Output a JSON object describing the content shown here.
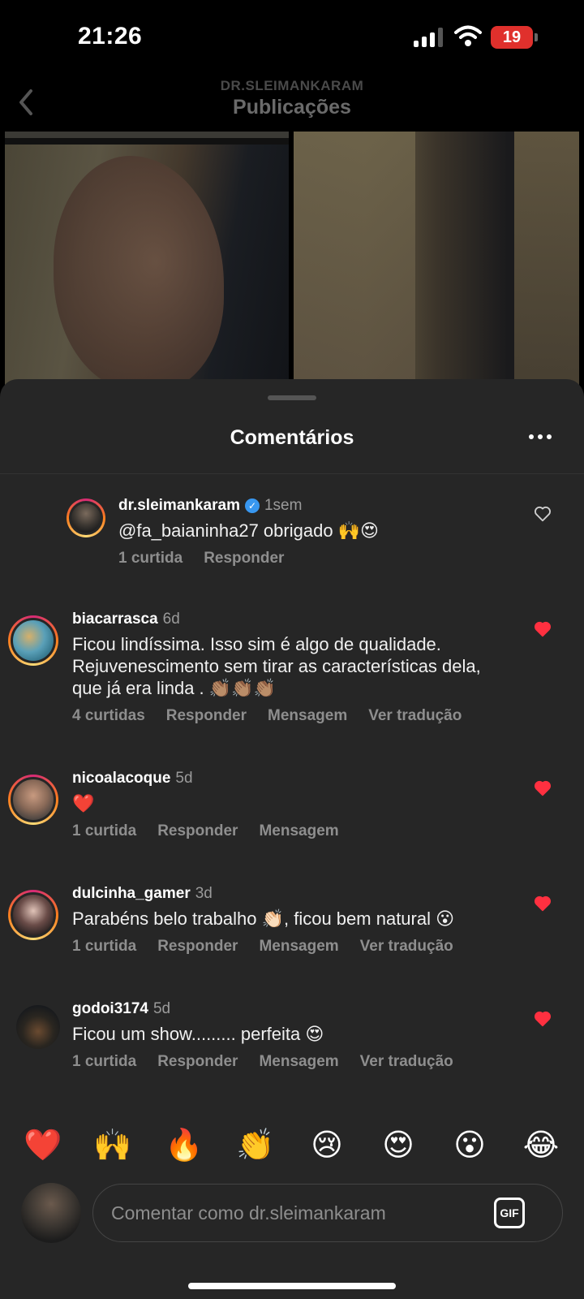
{
  "status_bar": {
    "time": "21:26",
    "battery": "19"
  },
  "header": {
    "subtitle": "DR.SLEIMANKARAM",
    "title": "Publicações"
  },
  "sheet": {
    "title": "Comentários"
  },
  "comments": [
    {
      "username": "dr.sleimankaram",
      "time": "1sem",
      "verified": true,
      "text": "@fa_baianinha27 obrigado 🙌😍",
      "likes": "1 curtida",
      "reply": "Responder",
      "message": "",
      "translate": "",
      "liked": false
    },
    {
      "username": "biacarrasca",
      "time": "6d",
      "text": "Ficou lindíssima. Isso sim é algo de qualidade. Rejuvenescimento sem tirar as características dela, que já era linda . 👏🏽👏🏽👏🏽",
      "likes": "4 curtidas",
      "reply": "Responder",
      "message": "Mensagem",
      "translate": "Ver tradução",
      "liked": true
    },
    {
      "username": "nicoalacoque",
      "time": "5d",
      "text": "❤️",
      "likes": "1 curtida",
      "reply": "Responder",
      "message": "Mensagem",
      "translate": "",
      "liked": true
    },
    {
      "username": "dulcinha_gamer",
      "time": "3d",
      "text": "Parabéns belo trabalho 👏🏻, ficou bem natural 😮",
      "likes": "1 curtida",
      "reply": "Responder",
      "message": "Mensagem",
      "translate": "Ver tradução",
      "liked": true
    },
    {
      "username": "godoi3174",
      "time": "5d",
      "text": "Ficou um show......... perfeita 😍",
      "likes": "1 curtida",
      "reply": "Responder",
      "message": "Mensagem",
      "translate": "Ver tradução",
      "liked": true
    }
  ],
  "reactions": [
    "❤️",
    "🙌",
    "🔥",
    "👏",
    "😢",
    "😍",
    "😮",
    "😂"
  ],
  "input": {
    "placeholder": "Comentar como dr.sleimankaram",
    "gif": "GIF"
  },
  "colors": {
    "like_red": "#ff3040",
    "sheet_bg": "#262626",
    "verified_blue": "#3897f0"
  }
}
